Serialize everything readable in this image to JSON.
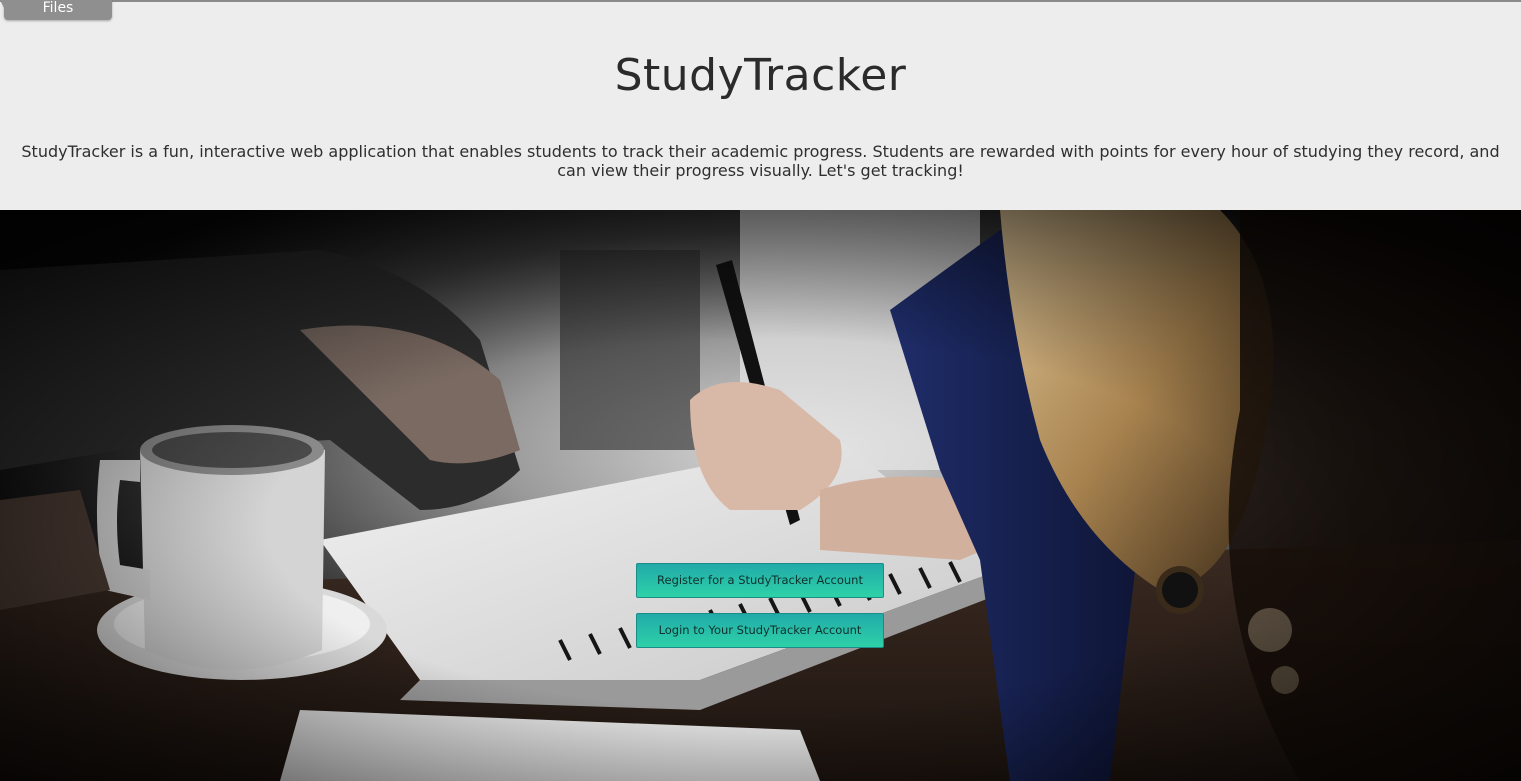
{
  "window": {
    "files_tab_label": "Files"
  },
  "header": {
    "title": "StudyTracker",
    "description": "StudyTracker is a fun, interactive web application that enables students to track their academic progress. Students are rewarded with points for every hour of studying they record, and can view their progress visually. Let's get tracking!"
  },
  "hero": {
    "register_label": "Register for a StudyTracker Account",
    "login_label": "Login to Your StudyTracker Account"
  },
  "colors": {
    "header_bg": "#ededed",
    "button_gradient_top": "#21aaa9",
    "button_gradient_bottom": "#2ed1a8",
    "title_text": "#2b2b2b"
  }
}
